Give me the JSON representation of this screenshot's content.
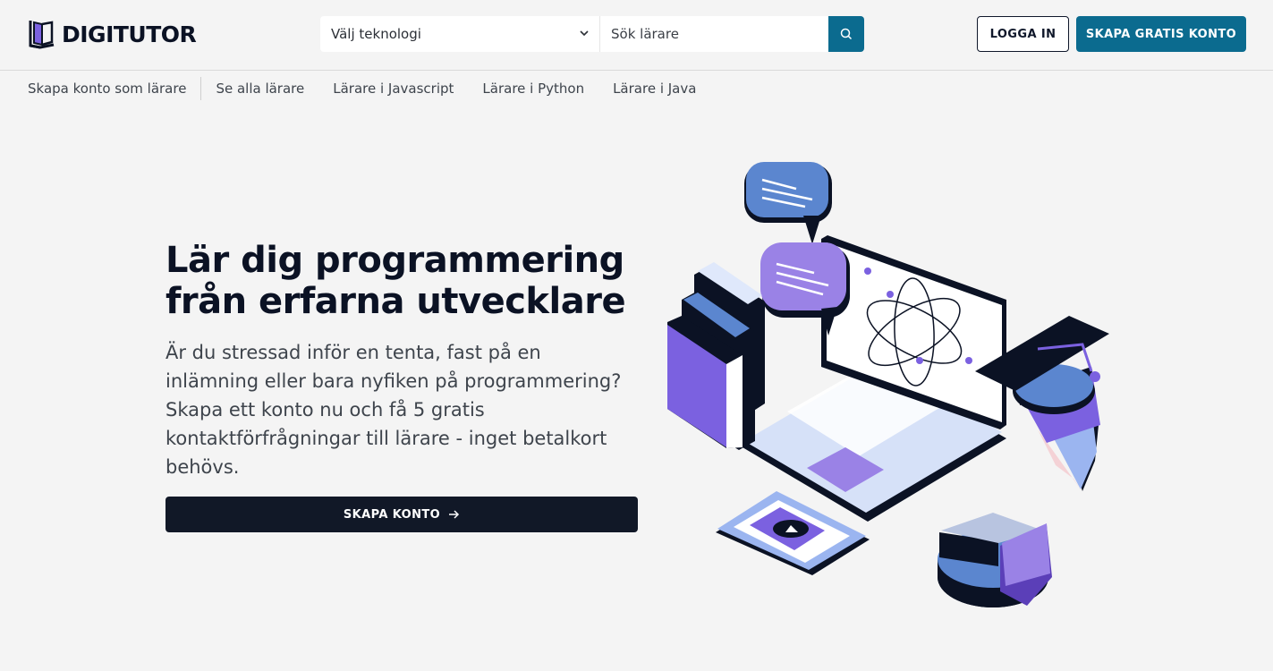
{
  "header": {
    "logo_text": "DIGITUTOR",
    "tech_select_value": "Välj teknologi",
    "search_placeholder": "Sök lärare",
    "login_label": "LOGGA IN",
    "signup_label": "SKAPA GRATIS KONTO"
  },
  "subnav": {
    "items": [
      {
        "label": "Skapa konto som lärare"
      },
      {
        "label": "Se alla lärare"
      },
      {
        "label": "Lärare i Javascript"
      },
      {
        "label": "Lärare i Python"
      },
      {
        "label": "Lärare i Java"
      }
    ]
  },
  "hero": {
    "title_line1": "Lär dig programmering",
    "title_line2": "från erfarna utvecklare",
    "description": "Är du stressad inför en tenta, fast på en inlämning eller bara nyfiken på programmering? Skapa ett konto nu och få 5 gratis kontaktförfrågningar till lärare - inget betalkort behövs.",
    "cta_label": "SKAPA KONTO"
  },
  "icons": {
    "logo": "book-logo-icon",
    "select": "chevron-down-icon",
    "search": "search-icon",
    "cta": "arrow-right-icon"
  },
  "colors": {
    "brand": "#0b6b8f",
    "dark": "#111827",
    "purple": "#7b61e0",
    "background": "#f4f4f4"
  }
}
